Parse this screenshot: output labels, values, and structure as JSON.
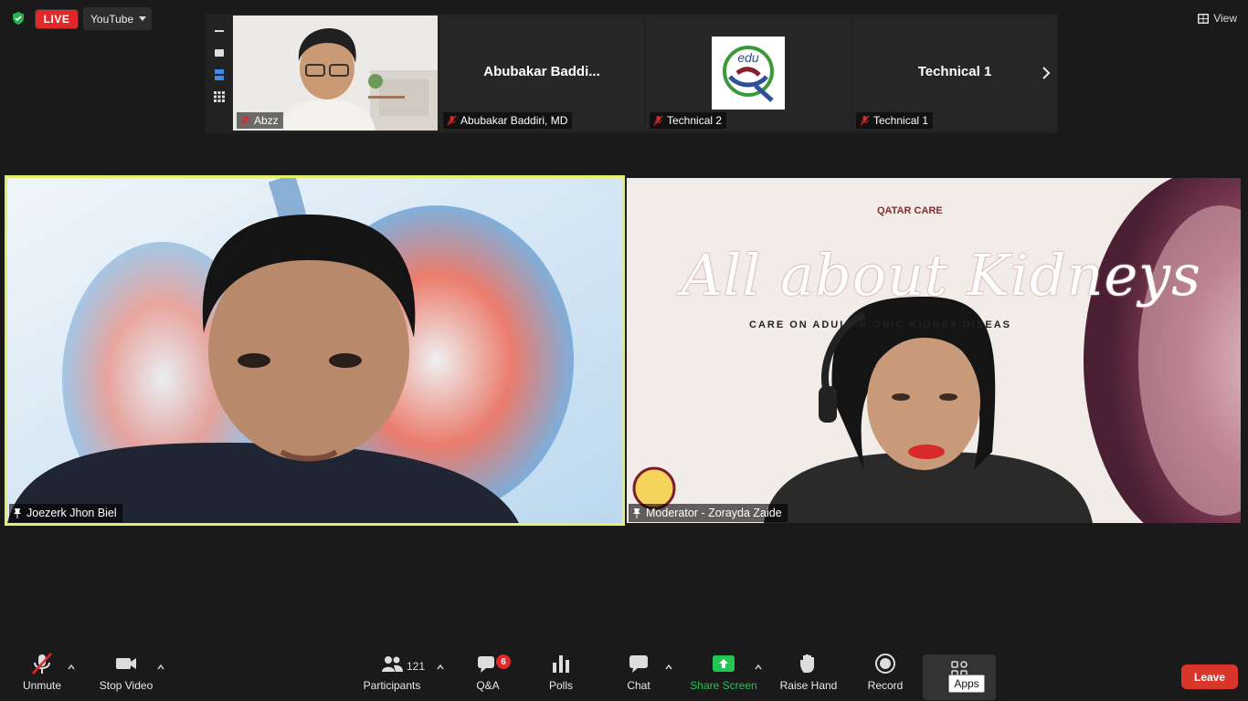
{
  "status": {
    "live_label": "LIVE",
    "stream_target": "YouTube",
    "view_label": "View"
  },
  "thumbnails": [
    {
      "name": "Abzz",
      "title": ""
    },
    {
      "name": "Abubakar Baddiri, MD",
      "title": "Abubakar  Baddi..."
    },
    {
      "name": "Technical 2",
      "title": ""
    },
    {
      "name": "Technical 1",
      "title": "Technical 1"
    }
  ],
  "tiles": {
    "left_name": "Joezerk Jhon Biel",
    "right_name": "Moderator - Zorayda Zaide"
  },
  "slide": {
    "logo_text": "QATAR CARE",
    "heading": "All about Kidneys",
    "subheading": "CARE ON ADULT P                ONIC KIDNEY DISEAS"
  },
  "toolbar": {
    "unmute": "Unmute",
    "stop_video": "Stop Video",
    "participants": "Participants",
    "participants_count": "121",
    "qa": "Q&A",
    "qa_badge": "6",
    "polls": "Polls",
    "chat": "Chat",
    "share_screen": "Share Screen",
    "raise_hand": "Raise Hand",
    "record": "Record",
    "apps_tooltip": "Apps",
    "leave": "Leave"
  },
  "colors": {
    "live_red": "#e02828",
    "active_speaker_border": "#e4f06a",
    "share_green": "#23c552",
    "leave_red": "#d9352b",
    "toolbar_bg": "#1a1a1a"
  }
}
